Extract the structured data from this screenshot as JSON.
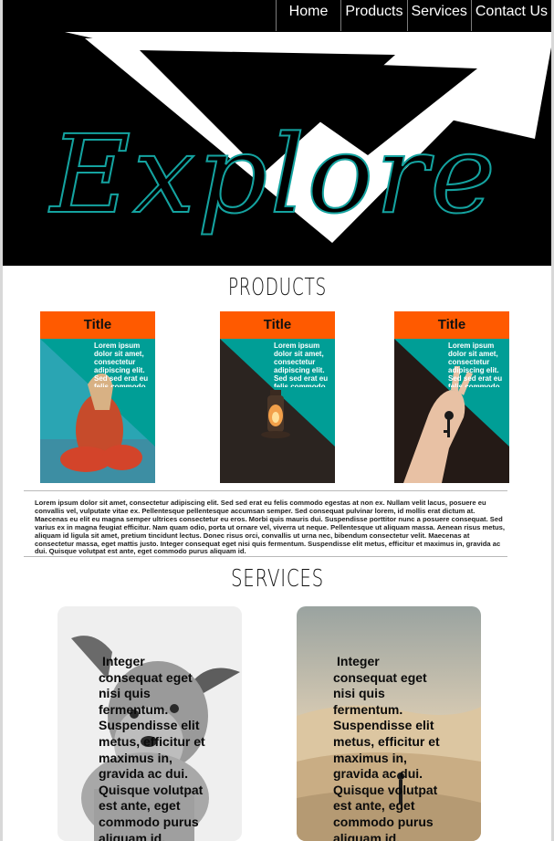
{
  "nav": {
    "items": [
      {
        "label": "Home"
      },
      {
        "label": "Products"
      },
      {
        "label": "Services"
      },
      {
        "label": "Contact Us"
      }
    ]
  },
  "hero": {
    "title": "Explore",
    "title_color": "#14a3a0",
    "background": "#000000"
  },
  "products": {
    "heading": "PRODUCTS",
    "cards": [
      {
        "title": "Title",
        "text": "Lorem ipsum dolor sit amet, consectetur adipiscing elit. Sed sed erat eu felis commodo egestas at non ex.",
        "image": "woman-sitting-photo"
      },
      {
        "title": "Title",
        "text": "Lorem ipsum dolor sit amet, consectetur adipiscing elit. Sed sed erat eu felis commodo egestas at non ex.",
        "image": "lantern-photo"
      },
      {
        "title": "Title",
        "text": "Lorem ipsum dolor sit amet, consectetur adipiscing elit. Sed sed erat eu felis commodo egestas at non ex.",
        "image": "hand-key-photo"
      }
    ],
    "paragraph": "Lorem ipsum dolor sit amet, consectetur adipiscing elit. Sed sed erat eu felis commodo egestas at non ex. Nullam velit lacus, posuere eu convallis vel, vulputate vitae ex. Pellentesque pellentesque accumsan semper. Sed consequat pulvinar lorem, id mollis erat dictum at. Maecenas eu elit eu magna semper ultrices consectetur eu eros. Morbi quis mauris dui. Suspendisse porttitor nunc a posuere consequat. Sed varius ex in magna feugiat efficitur. Nam quam odio, porta ut ornare vel, viverra ut neque. Pellentesque ut aliquam massa. Aenean risus metus, aliquam id ligula sit amet, pretium tincidunt lectus. Donec risus orci, convallis ut urna nec, bibendum consectetur velit. Maecenas at consectetur massa, eget mattis justo. Integer consequat eget nisi quis fermentum. Suspendisse elit metus, efficitur et maximus in, gravida ac dui. Quisque volutpat est ante, eget commodo purus aliquam id."
  },
  "services": {
    "heading": "SERVICES",
    "cards": [
      {
        "text_lines": [
          "Integer",
          "consequat eget",
          "nisi quis",
          "fermentum.",
          "Suspendisse elit",
          "metus, efficitur et",
          "maximus in,",
          "gravida ac dui.",
          "Quisque volutpat",
          "est ante, eget",
          "commodo purus",
          "aliquam id."
        ],
        "image": "dog-photo"
      },
      {
        "text_lines": [
          "Integer",
          "consequat eget",
          "nisi quis",
          "fermentum.",
          "Suspendisse elit",
          "metus, efficitur et",
          "maximus in,",
          "gravida ac dui.",
          "Quisque volutpat",
          "est ante, eget",
          "commodo purus",
          "aliquam id."
        ],
        "image": "desert-person-photo"
      }
    ]
  },
  "colors": {
    "accent_orange": "#ff5a00",
    "accent_teal": "#009e96"
  }
}
